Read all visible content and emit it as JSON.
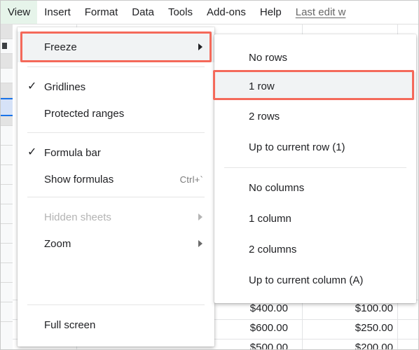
{
  "menubar": {
    "items": [
      {
        "label": "View",
        "active": true
      },
      {
        "label": "Insert",
        "active": false
      },
      {
        "label": "Format",
        "active": false
      },
      {
        "label": "Data",
        "active": false
      },
      {
        "label": "Tools",
        "active": false
      },
      {
        "label": "Add-ons",
        "active": false
      },
      {
        "label": "Help",
        "active": false
      }
    ],
    "last_edit": "Last edit w"
  },
  "view_menu": {
    "items": [
      {
        "label": "Freeze",
        "checked": false,
        "accel": "",
        "submenu": true,
        "disabled": false,
        "highlighted": true
      },
      {
        "label": "Gridlines",
        "checked": true,
        "accel": "",
        "submenu": false,
        "disabled": false,
        "highlighted": false
      },
      {
        "label": "Protected ranges",
        "checked": false,
        "accel": "",
        "submenu": false,
        "disabled": false,
        "highlighted": false
      },
      {
        "label": "Formula bar",
        "checked": true,
        "accel": "",
        "submenu": false,
        "disabled": false,
        "highlighted": false
      },
      {
        "label": "Show formulas",
        "checked": false,
        "accel": "Ctrl+`",
        "submenu": false,
        "disabled": false,
        "highlighted": false
      },
      {
        "label": "Hidden sheets",
        "checked": false,
        "accel": "",
        "submenu": true,
        "disabled": true,
        "highlighted": false
      },
      {
        "label": "Zoom",
        "checked": false,
        "accel": "",
        "submenu": true,
        "disabled": false,
        "highlighted": false
      },
      {
        "label": "Full screen",
        "checked": false,
        "accel": "",
        "submenu": false,
        "disabled": false,
        "highlighted": false
      }
    ],
    "check_glyph": "✓"
  },
  "freeze_submenu": {
    "items": [
      {
        "label": "No rows",
        "highlighted": false
      },
      {
        "label": "1 row",
        "highlighted": true
      },
      {
        "label": "2 rows",
        "highlighted": false
      },
      {
        "label": "Up to current row (1)",
        "highlighted": false
      },
      {
        "label": "No columns",
        "highlighted": false
      },
      {
        "label": "1 column",
        "highlighted": false
      },
      {
        "label": "2 columns",
        "highlighted": false
      },
      {
        "label": "Up to current column (A)",
        "highlighted": false
      }
    ]
  },
  "annotations": {
    "highlight_color": "#f4695a",
    "boxes": [
      {
        "target": "Freeze"
      },
      {
        "target": "1 row"
      }
    ]
  },
  "spreadsheet": {
    "visible_cells": [
      {
        "col1": "$400.00",
        "col2": "$100.00"
      },
      {
        "col1": "$600.00",
        "col2": "$250.00"
      },
      {
        "col1": "$500.00",
        "col2": "$200.00"
      }
    ]
  }
}
